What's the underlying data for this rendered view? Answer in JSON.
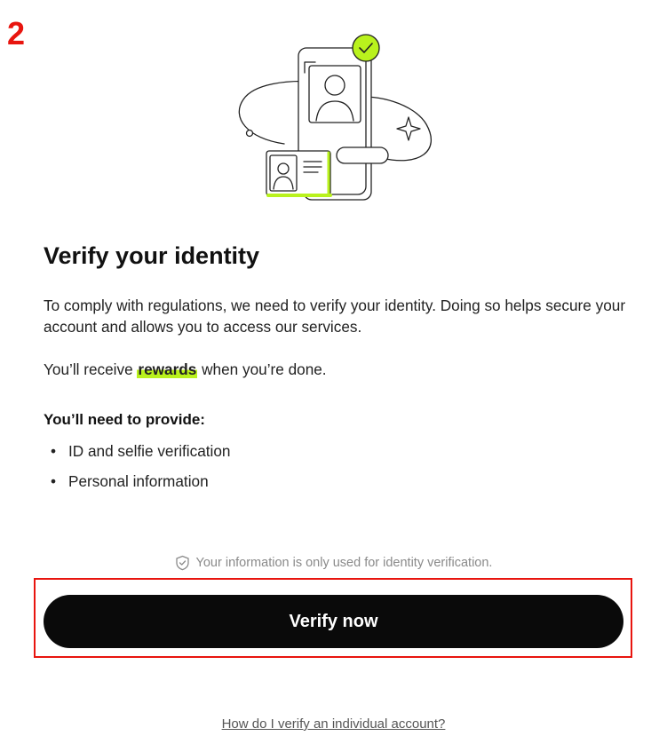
{
  "annotation": {
    "step_number": "2",
    "highlight_color": "#e8150f"
  },
  "illustration": {
    "icon": "id-verification-illustration",
    "accent_color": "#b9f21d"
  },
  "title": "Verify your identity",
  "intro": "To comply with regulations, we need to verify your identity. Doing so helps secure your account and allows you to access our services.",
  "rewards": {
    "prefix": "You’ll receive ",
    "highlight": "rewards",
    "suffix": " when you’re done."
  },
  "requirements": {
    "heading": "You’ll need to provide:",
    "items": [
      {
        "bullet": "•",
        "label": "ID and selfie verification"
      },
      {
        "bullet": "•",
        "label": "Personal information"
      }
    ]
  },
  "privacy_note": {
    "icon": "shield-check-icon",
    "text": "Your information is only used for identity verification."
  },
  "verify_button": {
    "label": "Verify now",
    "background": "#0a0a0a"
  },
  "help_link": {
    "label": "How do I verify an individual account?"
  }
}
